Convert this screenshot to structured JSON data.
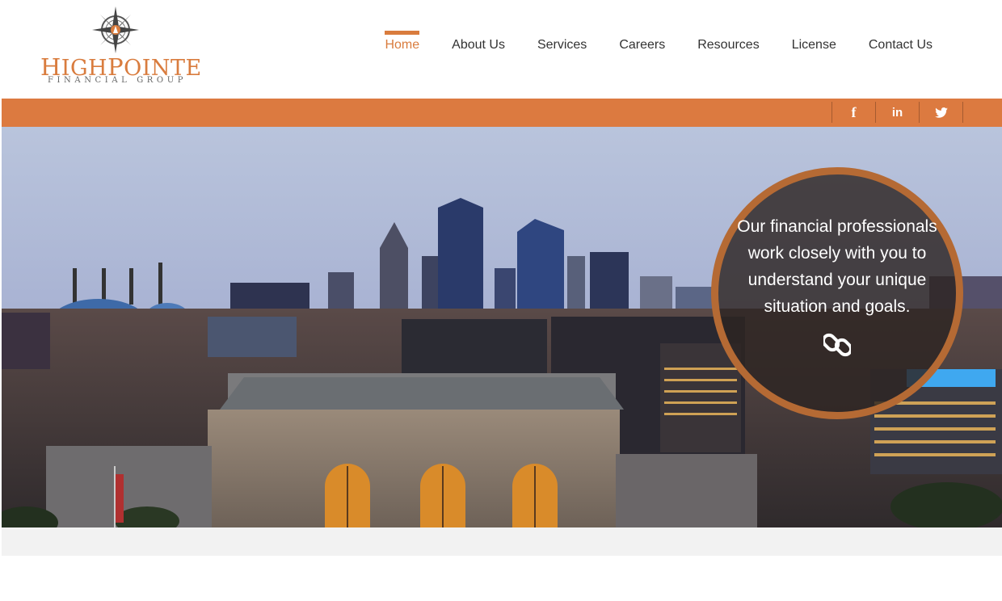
{
  "brand": {
    "name_first_cap": "H",
    "name_first_rest": "IGH",
    "name_second_cap": "P",
    "name_second_rest": "OINTE",
    "tagline": "FINANCIAL GROUP",
    "accent_color": "#d97c3e"
  },
  "nav": {
    "items": [
      {
        "label": "Home",
        "active": true
      },
      {
        "label": "About Us"
      },
      {
        "label": "Services"
      },
      {
        "label": "Careers"
      },
      {
        "label": "Resources"
      },
      {
        "label": "License"
      },
      {
        "label": "Contact Us"
      }
    ]
  },
  "social": {
    "facebook": "f",
    "linkedin": "in",
    "twitter_icon": "twitter-icon"
  },
  "hero": {
    "callout": "Our financial professionals work closely with you to understand your unique situation and goals.",
    "link_icon": "link-icon"
  }
}
